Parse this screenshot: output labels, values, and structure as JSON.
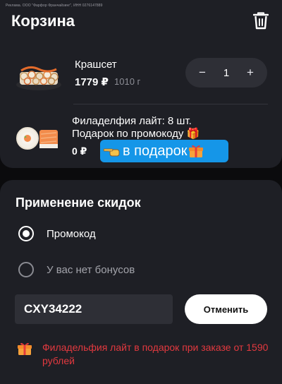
{
  "ad_text": "Реклама. ООО \"Фарфор Франчайзинг\", ИНН 0276147889",
  "cart": {
    "title": "Корзина",
    "items": [
      {
        "name": "Крашсет",
        "price": "1779 ₽",
        "weight": "1010 г",
        "quantity": "1",
        "minus_label": "−",
        "plus_label": "+"
      }
    ],
    "gift_item": {
      "line1": "Филаделфия лайт: 8 шт.",
      "line2": "Подарок по промокоду 🎁",
      "price": "0 ₽",
      "badge": "в подарок"
    }
  },
  "discounts": {
    "title": "Применение скидок",
    "options": [
      {
        "label": "Промокод",
        "selected": true
      },
      {
        "label": "У вас нет бонусов",
        "selected": false
      }
    ],
    "promo_code_value": "CXY34222",
    "cancel_label": "Отменить",
    "note": "Филадельфия лайт в подарок при заказе от 1590 рублей"
  },
  "colors": {
    "card_bg": "#1e1f25",
    "badge_blue": "#1596e8",
    "note_red": "#e3393f"
  },
  "icons": [
    "trash-icon",
    "pointing-hand-icon",
    "gift-icon"
  ]
}
